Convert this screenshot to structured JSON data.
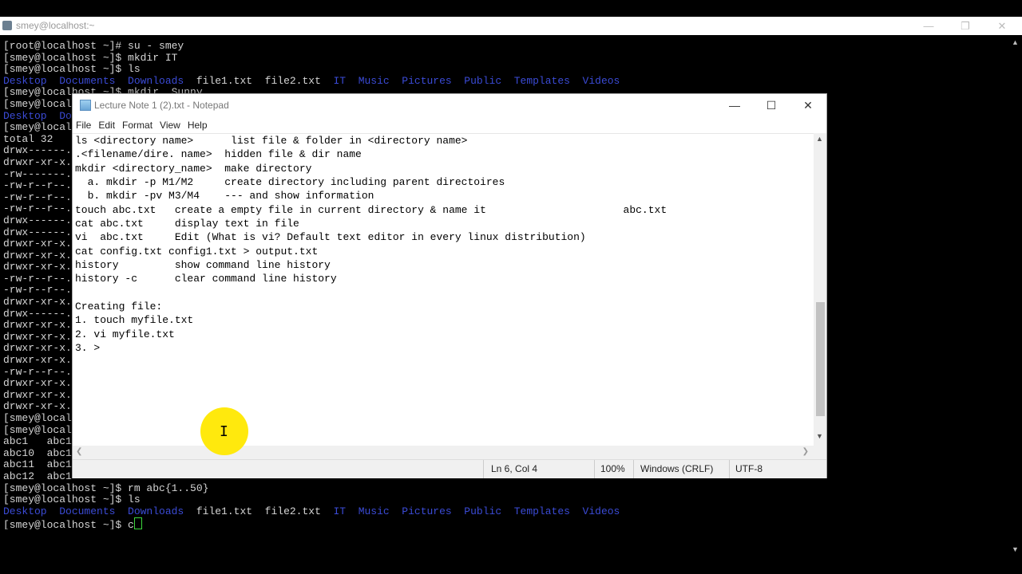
{
  "terminal": {
    "title": "smey@localhost:~",
    "lines": [
      [
        {
          "t": "[root@localhost ~]# su - smey"
        }
      ],
      [
        {
          "t": "[smey@localhost ~]$ mkdir IT"
        }
      ],
      [
        {
          "t": "[smey@localhost ~]$ ls"
        }
      ],
      [
        {
          "t": "Desktop  Documents  Downloads",
          "c": "blue"
        },
        {
          "t": "  file1.txt  file2.txt  "
        },
        {
          "t": "IT  Music  Pictures  Public  Templates  Videos",
          "c": "blue"
        }
      ],
      [
        {
          "t": "[smey@localhost ~]$ mkdir  Sunny"
        }
      ],
      [
        {
          "t": "[smey@localhost"
        }
      ],
      [
        {
          "t": "Desktop  Do",
          "c": "blue"
        }
      ],
      [
        {
          "t": "[smey@localhost"
        }
      ],
      [
        {
          "t": "total 32"
        }
      ],
      [
        {
          "t": "drwx------."
        }
      ],
      [
        {
          "t": "drwxr-xr-x."
        }
      ],
      [
        {
          "t": "-rw-------."
        }
      ],
      [
        {
          "t": "-rw-r--r--."
        }
      ],
      [
        {
          "t": "-rw-r--r--."
        }
      ],
      [
        {
          "t": "-rw-r--r--."
        }
      ],
      [
        {
          "t": "drwx------."
        }
      ],
      [
        {
          "t": "drwx------."
        }
      ],
      [
        {
          "t": "drwxr-xr-x."
        }
      ],
      [
        {
          "t": "drwxr-xr-x."
        }
      ],
      [
        {
          "t": "drwxr-xr-x."
        }
      ],
      [
        {
          "t": "-rw-r--r--."
        }
      ],
      [
        {
          "t": "-rw-r--r--."
        }
      ],
      [
        {
          "t": "drwxr-xr-x."
        }
      ],
      [
        {
          "t": "drwx------."
        }
      ],
      [
        {
          "t": "drwxr-xr-x."
        }
      ],
      [
        {
          "t": "drwxr-xr-x."
        }
      ],
      [
        {
          "t": "drwxr-xr-x."
        }
      ],
      [
        {
          "t": "drwxr-xr-x."
        }
      ],
      [
        {
          "t": "-rw-r--r--."
        }
      ],
      [
        {
          "t": "drwxr-xr-x."
        }
      ],
      [
        {
          "t": "drwxr-xr-x."
        }
      ],
      [
        {
          "t": "drwxr-xr-x."
        }
      ],
      [
        {
          "t": "[smey@localhost"
        }
      ],
      [
        {
          "t": "[smey@localhost"
        }
      ],
      [
        {
          "t": "abc1   abc1"
        }
      ],
      [
        {
          "t": "abc10  abc1"
        }
      ],
      [
        {
          "t": "abc11  abc1"
        }
      ],
      [
        {
          "t": "abc12  abc1"
        }
      ],
      [
        {
          "t": "[smey@localhost ~]$ rm abc{1..50}"
        }
      ],
      [
        {
          "t": "[smey@localhost ~]$ ls"
        }
      ],
      [
        {
          "t": "Desktop  Documents  Downloads",
          "c": "blue"
        },
        {
          "t": "  file1.txt  file2.txt  "
        },
        {
          "t": "IT  Music  Pictures  Public  Templates  Videos",
          "c": "blue"
        }
      ],
      [
        {
          "t": "[smey@localhost ~]$ c"
        }
      ]
    ]
  },
  "notepad": {
    "title": "Lecture Note 1 (2).txt - Notepad",
    "menu": [
      "File",
      "Edit",
      "Format",
      "View",
      "Help"
    ],
    "lines": [
      "ls <directory name>      list file & folder in <directory name>",
      ".<filename/dire. name>  hidden file & dir name",
      "mkdir <directory_name>  make directory",
      "  a. mkdir -p M1/M2     create directory including parent directoires",
      "  b. mkdir -pv M3/M4    --- and show information",
      "touch abc.txt   create a empty file in current directory & name it                      abc.txt",
      "cat abc.txt     display text in file",
      "vi  abc.txt     Edit (What is vi? Default text editor in every linux distribution)",
      "cat config.txt config1.txt > output.txt",
      "history         show command line history",
      "history -c      clear command line history",
      "",
      "Creating file:",
      "1. touch myfile.txt",
      "2. vi myfile.txt",
      "3. >"
    ],
    "status": {
      "position": "Ln 6, Col 4",
      "zoom": "100%",
      "line_ending": "Windows (CRLF)",
      "encoding": "UTF-8"
    }
  },
  "colors": {
    "terminal_bg": "#000000",
    "terminal_blue": "#3b4bd6",
    "cursor_highlight": "#ffe800"
  }
}
